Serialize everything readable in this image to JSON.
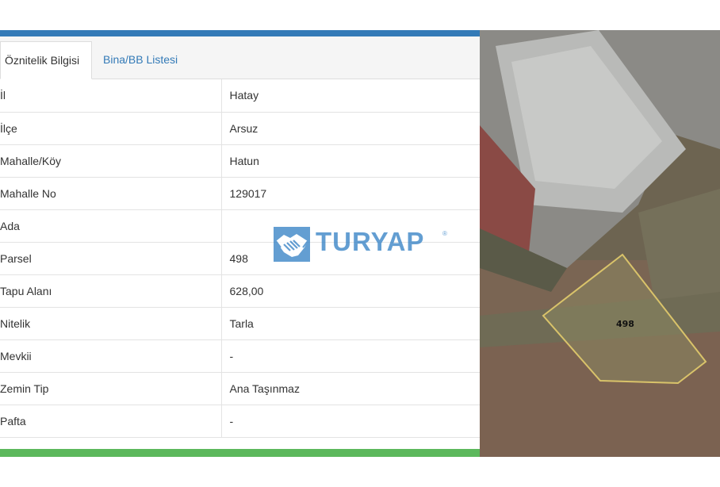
{
  "tabs": [
    {
      "label": "Öznitelik Bilgisi",
      "active": true
    },
    {
      "label": "Bina/BB Listesi",
      "active": false
    }
  ],
  "attributes": [
    {
      "label": "İl",
      "value": "Hatay"
    },
    {
      "label": "İlçe",
      "value": "Arsuz"
    },
    {
      "label": "Mahalle/Köy",
      "value": "Hatun"
    },
    {
      "label": "Mahalle No",
      "value": "129017"
    },
    {
      "label": "Ada",
      "value": ""
    },
    {
      "label": "Parsel",
      "value": "498"
    },
    {
      "label": "Tapu Alanı",
      "value": "628,00"
    },
    {
      "label": "Nitelik",
      "value": "Tarla"
    },
    {
      "label": "Mevkii",
      "value": "-"
    },
    {
      "label": "Zemin Tip",
      "value": "Ana Taşınmaz"
    },
    {
      "label": "Pafta",
      "value": "-"
    }
  ],
  "watermark": {
    "text": "TURYAP",
    "registered": "®",
    "icon": "handshake-icon"
  },
  "map": {
    "parcel_label": "498",
    "parcel_outline_color": "#d9c36a"
  },
  "colors": {
    "top_bar": "#337ab7",
    "bottom_bar": "#5cb85c",
    "link": "#337ab7"
  }
}
